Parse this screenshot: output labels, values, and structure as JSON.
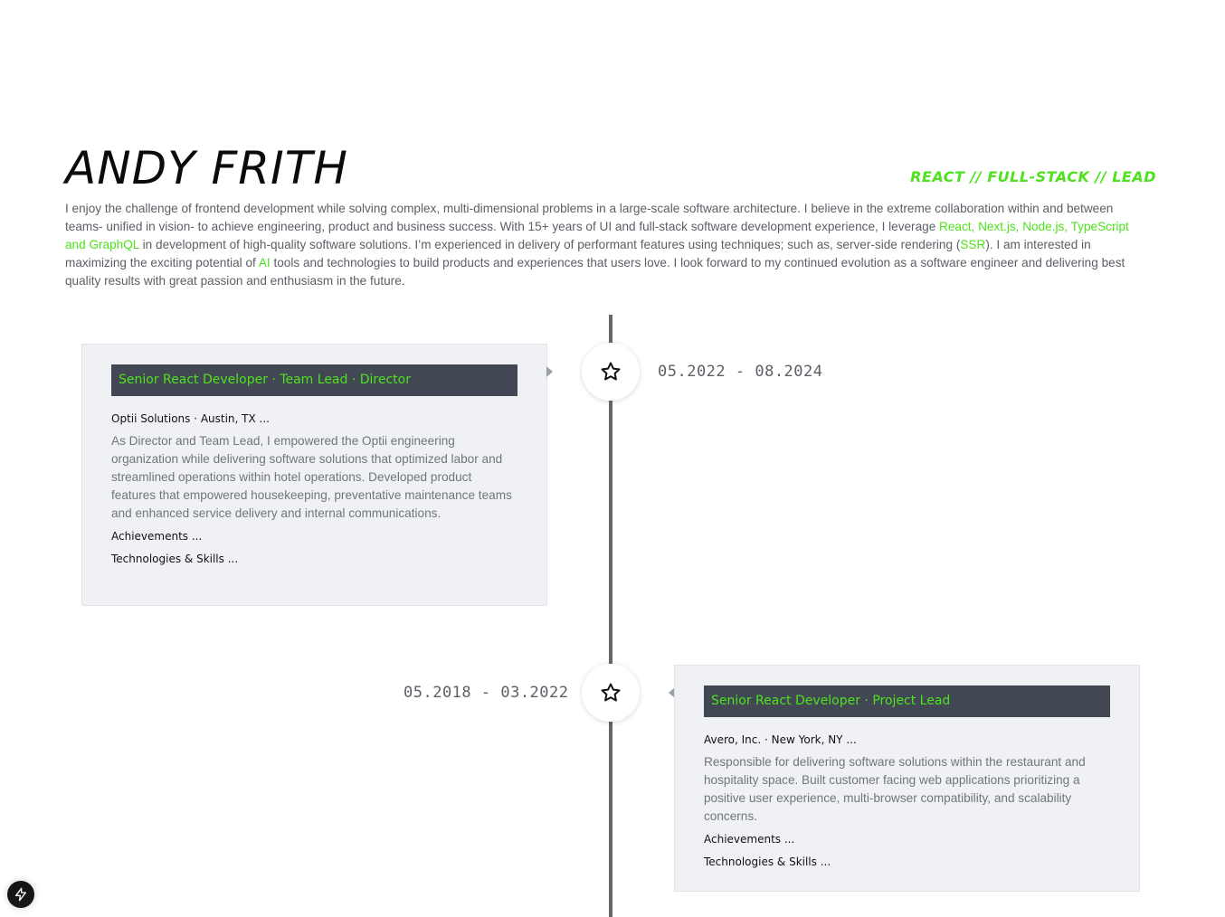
{
  "header": {
    "name": "ANDY FRITH",
    "tagline": "REACT // FULL-STACK // LEAD"
  },
  "intro": {
    "part1": "I enjoy the challenge of frontend development while solving complex, multi-dimensional problems in a large-scale software architecture. I believe in the extreme collaboration within and between teams- unified in vision- to achieve engineering, product and business success. With 15+ years of UI and full-stack software development experience, I leverage ",
    "tech_highlight": "React, Next.js, Node.js, TypeScript and GraphQL",
    "part2": " in development of high-quality software solutions. I’m experienced in delivery of performant features using techniques; such as, server-side rendering (",
    "ssr_highlight": "SSR",
    "part3": "). I am interested in maximizing the exciting potential of ",
    "ai_highlight": "AI",
    "part4": " tools and technologies to build products and experiences that users love. I look forward to my continued evolution as a software engineer and delivering best quality results with great passion and enthusiasm in the future."
  },
  "timeline": [
    {
      "title": "Senior React Developer · Team Lead · Director",
      "company": "Optii Solutions · Austin, TX ...",
      "description": "As Director and Team Lead, I empowered the Optii engineering organization while delivering software solutions that optimized labor and streamlined operations within hotel operations. Developed product features that empowered housekeeping, preventative maintenance teams and enhanced service delivery and internal communications.",
      "achievements_label": "Achievements ...",
      "skills_label": "Technologies & Skills ...",
      "dates": "05.2022 - 08.2024",
      "icon": "star-icon"
    },
    {
      "title": "Senior React Developer · Project Lead",
      "company": "Avero, Inc. · New York, NY ...",
      "description": "Responsible for delivering software solutions within the restaurant and hospitality space. Built customer facing web applications prioritizing a positive user experience, multi-browser compatibility, and scalability concerns.",
      "achievements_label": "Achievements ...",
      "skills_label": "Technologies & Skills ...",
      "dates": "05.2018 - 03.2022",
      "icon": "star-icon"
    }
  ],
  "colors": {
    "accent": "#4ee11e",
    "title_bar": "#424754",
    "card_bg": "#f0f1f5",
    "line": "#666666"
  },
  "floating_button": {
    "icon": "lightning-bolt-icon"
  }
}
